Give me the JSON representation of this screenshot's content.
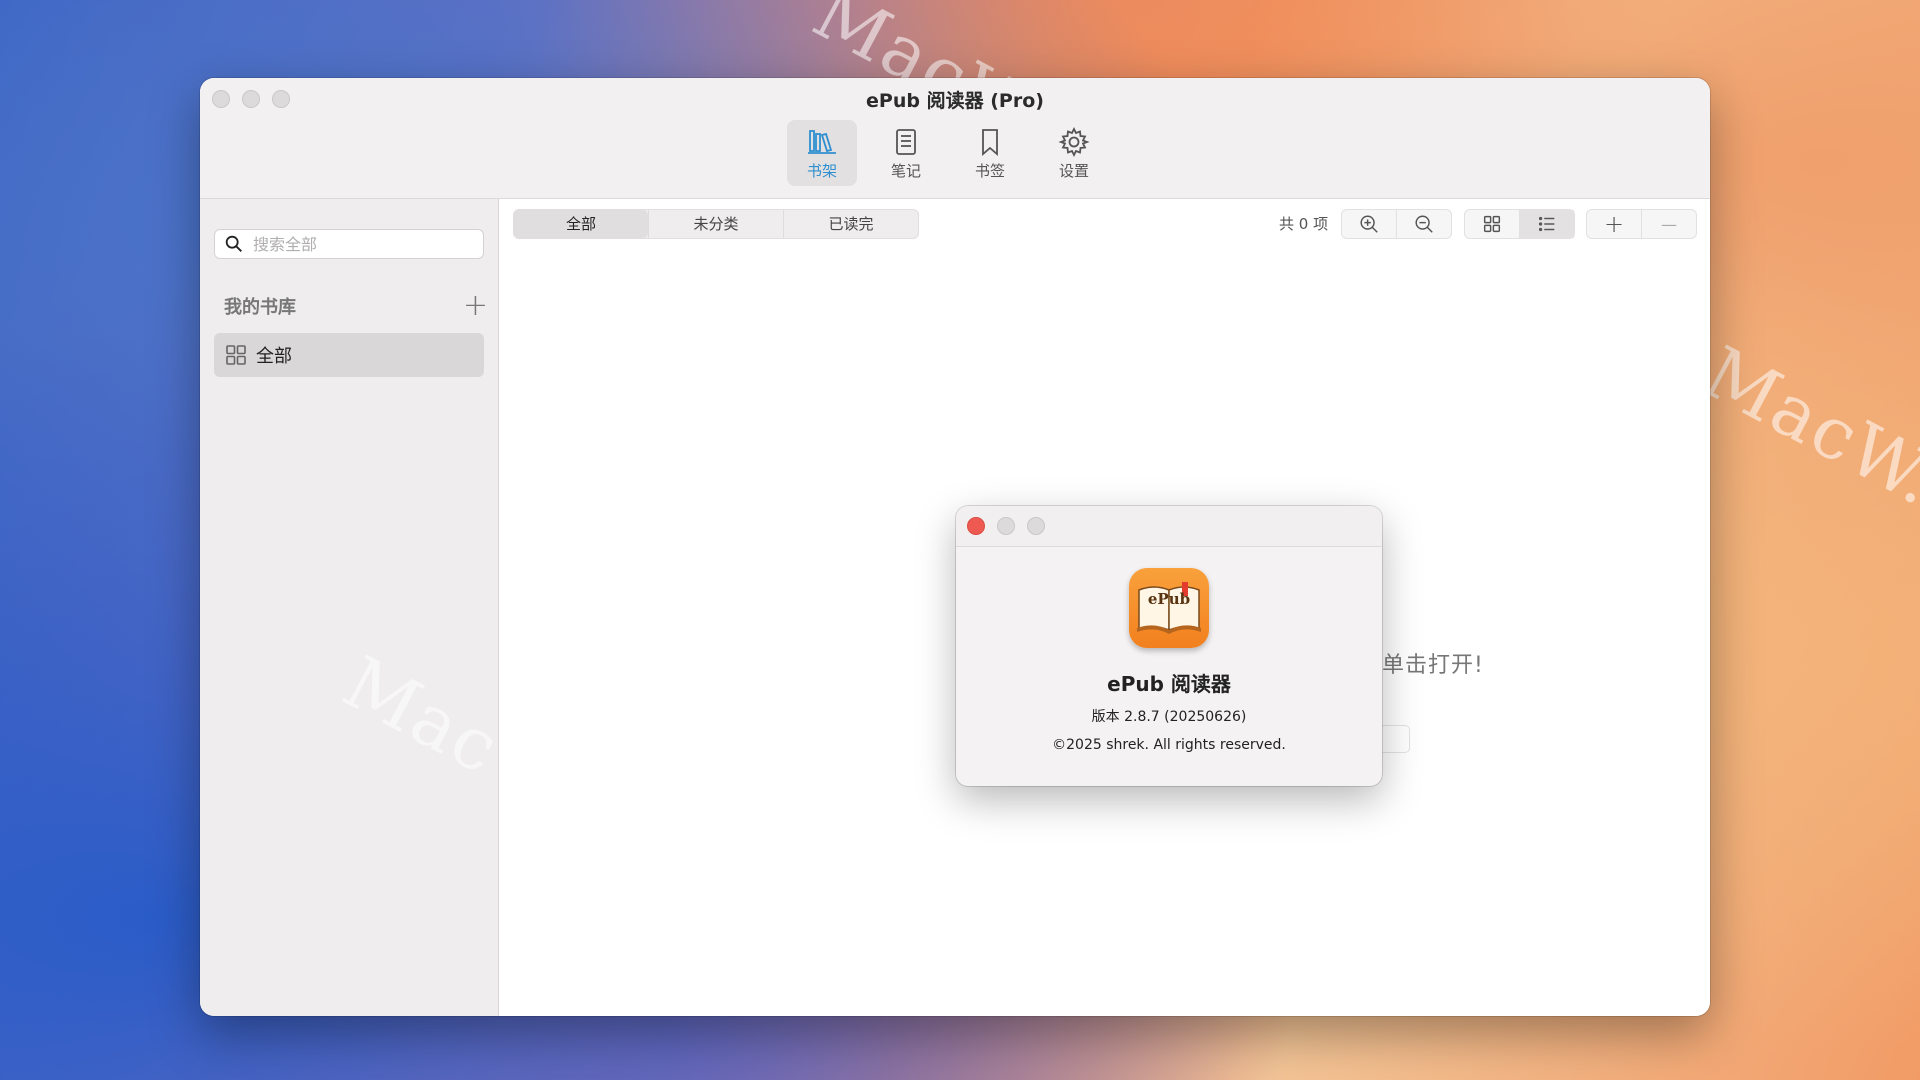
{
  "window": {
    "title": "ePub 阅读器 (Pro)"
  },
  "toolbar": {
    "items": [
      {
        "label": "书架",
        "icon": "bookshelf-icon",
        "active": true
      },
      {
        "label": "笔记",
        "icon": "notes-icon",
        "active": false
      },
      {
        "label": "书签",
        "icon": "bookmark-icon",
        "active": false
      },
      {
        "label": "设置",
        "icon": "gear-icon",
        "active": false
      }
    ]
  },
  "sidebar": {
    "search_placeholder": "搜索全部",
    "library_title": "我的书库",
    "add_label": "+",
    "items": [
      {
        "label": "全部",
        "icon": "grid-icon",
        "selected": true
      }
    ]
  },
  "main": {
    "filters": [
      {
        "label": "全部",
        "selected": true
      },
      {
        "label": "未分类",
        "selected": false
      },
      {
        "label": "已读完",
        "selected": false
      }
    ],
    "count_text": "共 0 项",
    "zoom_in_icon": "zoom-in-icon",
    "zoom_out_icon": "zoom-out-icon",
    "view_modes": [
      "grid-view-icon",
      "list-view-icon"
    ],
    "add_label": "+",
    "remove_label": "—",
    "empty_hint_visible": "或单击打开!"
  },
  "about_dialog": {
    "icon_text": "ePub",
    "app_name": "ePub 阅读器",
    "version": "版本 2.8.7 (20250626)",
    "copyright": "©2025 shrek. All rights reserved."
  },
  "watermarks": [
    "MacW.com",
    "MacW.com",
    "MacW.c"
  ],
  "colors": {
    "accent": "#2f8fd1",
    "close_red": "#ee5a52",
    "icon_orange": "#f2801e"
  }
}
